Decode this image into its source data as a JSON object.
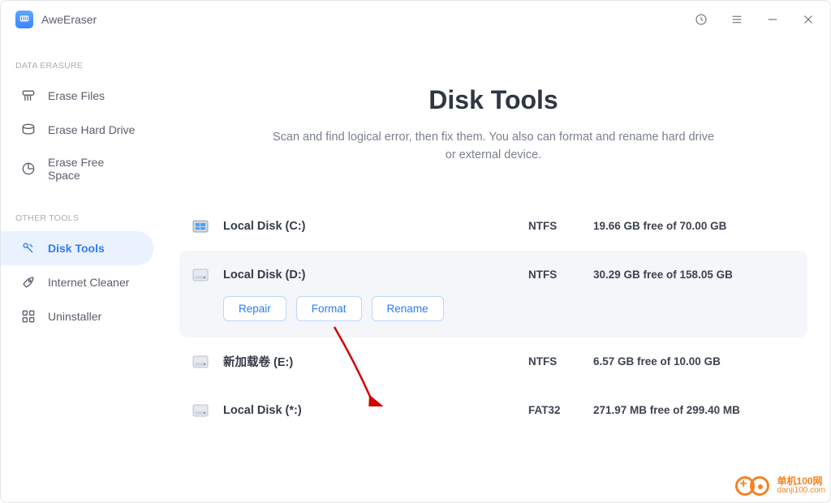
{
  "app": {
    "name": "AweEraser"
  },
  "sidebar": {
    "section1_label": "DATA ERASURE",
    "section2_label": "OTHER TOOLS",
    "items1": [
      {
        "label": "Erase Files"
      },
      {
        "label": "Erase Hard Drive"
      },
      {
        "label": "Erase Free Space"
      }
    ],
    "items2": [
      {
        "label": "Disk Tools"
      },
      {
        "label": "Internet Cleaner"
      },
      {
        "label": "Uninstaller"
      }
    ]
  },
  "page": {
    "title": "Disk Tools",
    "subtitle": "Scan and find logical error, then fix them. You also can format and rename hard drive or external device."
  },
  "actions": {
    "repair": "Repair",
    "format": "Format",
    "rename": "Rename"
  },
  "disks": [
    {
      "name": "Local Disk (C:)",
      "fs": "NTFS",
      "space": "19.66 GB free of 70.00 GB",
      "selected": false,
      "os": true
    },
    {
      "name": "Local Disk (D:)",
      "fs": "NTFS",
      "space": "30.29 GB free of 158.05 GB",
      "selected": true,
      "os": false
    },
    {
      "name": "新加载卷 (E:)",
      "fs": "NTFS",
      "space": "6.57 GB free of 10.00 GB",
      "selected": false,
      "os": false
    },
    {
      "name": "Local Disk (*:)",
      "fs": "FAT32",
      "space": "271.97 MB free of 299.40 MB",
      "selected": false,
      "os": false
    }
  ],
  "watermark": {
    "line1": "单机100网",
    "line2": "danji100.com"
  }
}
